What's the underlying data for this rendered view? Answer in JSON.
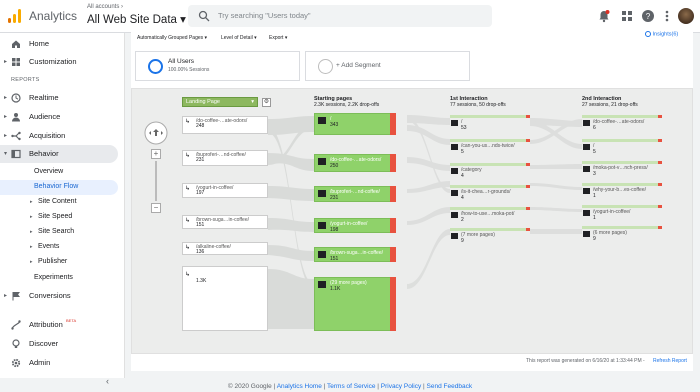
{
  "header": {
    "brand": "Analytics",
    "account_crumb": "All accounts ›",
    "property": "All Web Site Data ▾",
    "search_placeholder": "Try searching \"Users today\""
  },
  "sidebar": {
    "home": "Home",
    "customization": "Customization",
    "reports_heading": "REPORTS",
    "realtime": "Realtime",
    "audience": "Audience",
    "acquisition": "Acquisition",
    "behavior": "Behavior",
    "behavior_sub": [
      "Overview",
      "Behavior Flow",
      "Site Content",
      "Site Speed",
      "Site Search",
      "Events",
      "Publisher",
      "Experiments"
    ],
    "conversions": "Conversions",
    "attribution": "Attribution",
    "attribution_badge": "BETA",
    "discover": "Discover",
    "admin": "Admin"
  },
  "toolbar": {
    "grouping": "Automatically Grouped Pages ▾",
    "detail": "Level of Detail ▾",
    "export": "Export ▾",
    "insights": "Insights(6)"
  },
  "segments": {
    "all_users": "All Users",
    "all_users_pct": "100.00% Sessions",
    "add_segment": "+ Add Segment"
  },
  "flow": {
    "landing_select": "Landing Page",
    "starting_title": "Starting pages",
    "starting_stats": "2.3K sessions, 2.2K drop-offs",
    "first_title": "1st Interaction",
    "first_stats": "77 sessions, 50 drop-offs",
    "second_title": "2nd Interaction",
    "second_stats": "27 sessions, 21 drop-offs",
    "landing": [
      {
        "name": "/do-coffee-…ate-odors/",
        "value": "248"
      },
      {
        "name": "/buproferi-…nd-coffee/",
        "value": "231"
      },
      {
        "name": "/yogurt-in-coffee/",
        "value": "197"
      },
      {
        "name": "/brown-suga…in-coffee/",
        "value": "151"
      },
      {
        "name": "/alkaline-coffee/",
        "value": "136"
      },
      {
        "name": "",
        "value": "1.3K"
      }
    ],
    "starting": [
      {
        "name": "/",
        "value": "343"
      },
      {
        "name": "/do-coffee-…ate-odors/",
        "value": "250"
      },
      {
        "name": "/buproferi-…nd-coffee/",
        "value": "231"
      },
      {
        "name": "/yogurt-in-coffee/",
        "value": "198"
      },
      {
        "name": "/brown-suga…in-coffee/",
        "value": "151"
      },
      {
        "name": "(29 more pages)",
        "value": "1.1K"
      }
    ],
    "first": [
      {
        "name": "/",
        "value": "53"
      },
      {
        "name": "/can-you-us…nds-twice/",
        "value": "5"
      },
      {
        "name": "/category",
        "value": "4"
      },
      {
        "name": "/is-it-chea…r-grounds/",
        "value": "4"
      },
      {
        "name": "/how-to-use…moka-pot/",
        "value": "2"
      },
      {
        "name": "(7 more pages)",
        "value": "9"
      }
    ],
    "second": [
      {
        "name": "/do-coffee-…ate-odors/",
        "value": "6"
      },
      {
        "name": "/",
        "value": "5"
      },
      {
        "name": "/moka-pot-v…nch-press/",
        "value": "3"
      },
      {
        "name": "/why-your-b…es-coffee/",
        "value": "1"
      },
      {
        "name": "/yogurt-in-coffee/",
        "value": "1"
      },
      {
        "name": "(6 more pages)",
        "value": "9"
      }
    ]
  },
  "report_note": "This report was generated on 6/16/20 at 1:33:44 PM -",
  "refresh": "Refresh Report",
  "footer": {
    "copyright": "© 2020 Google",
    "links": [
      "Analytics Home",
      "Terms of Service",
      "Privacy Policy",
      "Send Feedback"
    ]
  }
}
